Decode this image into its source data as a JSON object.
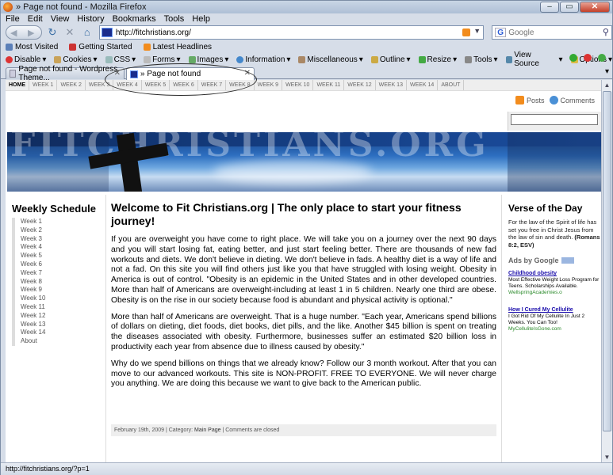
{
  "window": {
    "title": "» Page not found - Mozilla Firefox"
  },
  "menu": [
    "File",
    "Edit",
    "View",
    "History",
    "Bookmarks",
    "Tools",
    "Help"
  ],
  "nav": {
    "url": "http://fitchristians.org/",
    "search_placeholder": "Google"
  },
  "bookmarks": [
    "Most Visited",
    "Getting Started",
    "Latest Headlines"
  ],
  "devtoolbar": [
    "Disable",
    "Cookies",
    "CSS",
    "Forms",
    "Images",
    "Information",
    "Miscellaneous",
    "Outline",
    "Resize",
    "Tools",
    "View Source",
    "Options"
  ],
  "tabs": [
    {
      "label": "Page not found - Wordpress Theme...",
      "active": false
    },
    {
      "label": "» Page not found",
      "active": true
    }
  ],
  "site": {
    "nav": [
      "HOME",
      "WEEK 1",
      "WEEK 2",
      "WEEK 3",
      "WEEK 4",
      "WEEK 5",
      "WEEK 6",
      "WEEK 7",
      "WEEK 8",
      "WEEK 9",
      "WEEK 10",
      "WEEK 11",
      "WEEK 12",
      "WEEK 13",
      "WEEK 14",
      "ABOUT"
    ],
    "posts_label": "Posts",
    "comments_label": "Comments",
    "banner_text": "FITCHRISTIANS.ORG",
    "schedule": {
      "title": "Weekly Schedule",
      "items": [
        "Week 1",
        "Week 2",
        "Week 3",
        "Week 4",
        "Week 5",
        "Week 6",
        "Week 7",
        "Week 8",
        "Week 9",
        "Week 10",
        "Week 11",
        "Week 12",
        "Week 13",
        "Week 14",
        "About"
      ]
    },
    "post": {
      "title": "Welcome to Fit Christians.org | The only place to start your fitness journey!",
      "p1": "If you are overweight you have come to right place.  We will take you on a journey over the next 90 days and you will start losing fat, eating better, and just start feeling better.  There are thousands of new fad workouts and diets.  We don't believe in dieting.  We don't believe in fads.  A healthy diet is a way of life and not a fad.  On this site you will find others just like you that have struggled with losing weight. Obesity in America is out of control.  \"Obesity is an epidemic in the United States and in other developed countries. More than half of Americans are overweight-including at least 1 in 5 children. Nearly one third are obese. Obesity is on the rise in our society because food is abundant and physical activity is optional.\"",
      "p2": "More than half of Americans are overweight.  That is a huge number.  \"Each year, Americans spend billions of dollars on dieting, diet foods, diet books, diet pills, and the like. Another $45 billion is spent on treating the diseases associated with obesity. Furthermore, businesses suffer an estimated $20 billion loss in productivity each year from absence due to illness caused by obesity.\"",
      "p3": "Why do we spend billions on things that we already know?  Follow our 3 month workout.  After that you can move to our advanced workouts.  This site is NON-PROFIT.  FREE TO EVERYONE. We will never charge you anything.  We are doing this because we want to give back to the American public.",
      "meta_date": "February 19th, 2009 | Category: ",
      "meta_category": "Main Page",
      "meta_comments": " | Comments are closed"
    },
    "verse": {
      "title": "Verse of the Day",
      "text": "For the law of the Spirit of life has set you free in Christ Jesus from the law of sin and death.",
      "ref": "(Romans 8:2, ESV)"
    },
    "ads": {
      "label": "Ads by Google",
      "items": [
        {
          "headline": "Childhood obesity",
          "body": "Most Effective Weight Loss Program for Teens. Scholarships Available.",
          "url": "WellspringAcademies.o"
        },
        {
          "headline": "How I Cured My Cellulite",
          "body": "I Got Rid Of My Cellulite In Just 2 Weeks. You Can Too!",
          "url": "MyCelluliteIsGone.com"
        }
      ]
    }
  },
  "status": {
    "text": "http://fitchristians.org/?p=1"
  }
}
